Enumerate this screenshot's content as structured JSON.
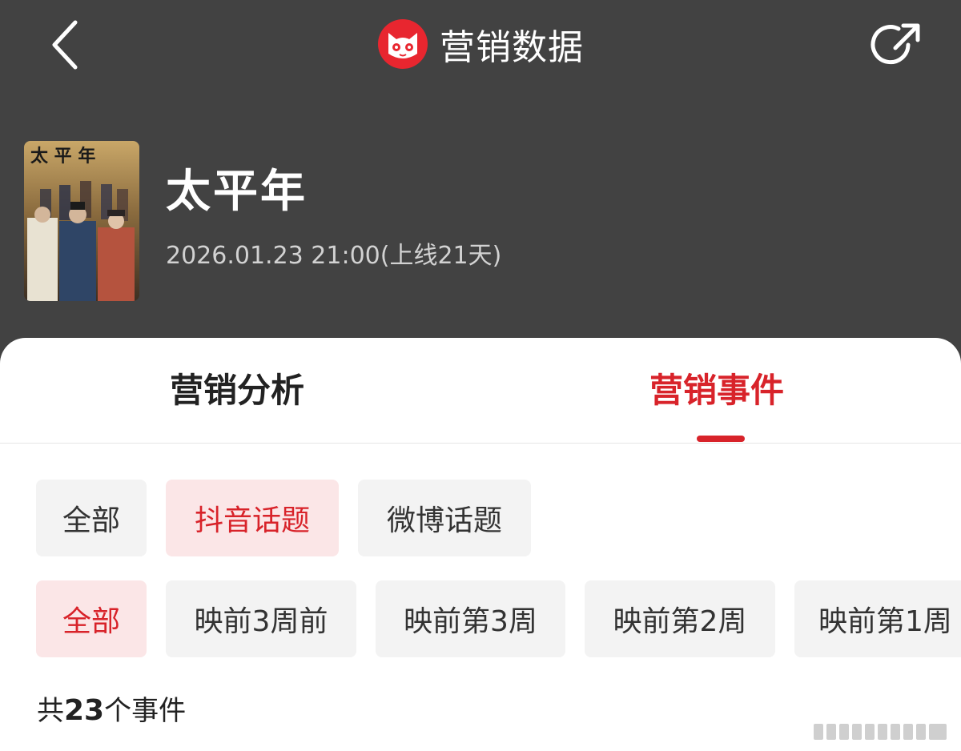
{
  "header": {
    "app_title": "营销数据",
    "back_icon": "chevron-left-icon",
    "share_icon": "share-icon",
    "logo": "maoyan-cat-logo"
  },
  "movie": {
    "title": "太平年",
    "release": "2026.01.23 21:00(上线21天)",
    "poster_text": "太平年"
  },
  "tabs": [
    {
      "label": "营销分析",
      "active": false
    },
    {
      "label": "营销事件",
      "active": true
    }
  ],
  "platform_filters": [
    {
      "label": "全部",
      "active": false
    },
    {
      "label": "抖音话题",
      "active": true
    },
    {
      "label": "微博话题",
      "active": false
    }
  ],
  "week_filters": [
    {
      "label": "全部",
      "active": true
    },
    {
      "label": "映前3周前",
      "active": false
    },
    {
      "label": "映前第3周",
      "active": false
    },
    {
      "label": "映前第2周",
      "active": false
    },
    {
      "label": "映前第1周",
      "active": false
    }
  ],
  "summary": {
    "prefix": "共",
    "count": "23",
    "suffix": "个事件"
  },
  "colors": {
    "header_bg": "#424242",
    "accent": "#d8232a",
    "chip_bg": "#f3f3f3",
    "chip_active_bg": "#fbe6e7"
  }
}
